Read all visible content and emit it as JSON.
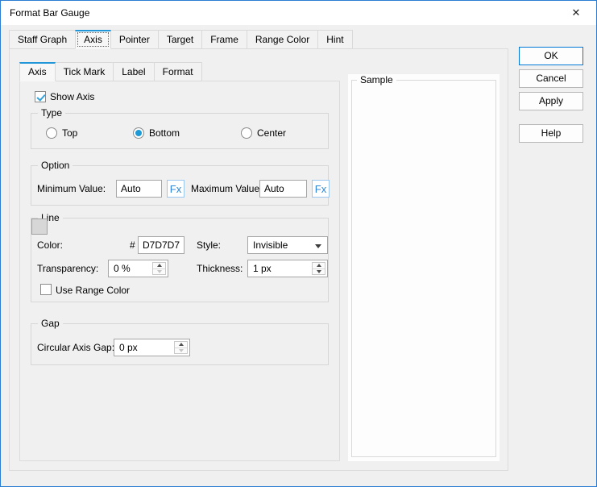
{
  "window": {
    "title": "Format Bar Gauge"
  },
  "icons": {
    "close": "✕"
  },
  "tabs": {
    "active": "Axis",
    "items": [
      {
        "label": "Staff Graph"
      },
      {
        "label": "Axis"
      },
      {
        "label": "Pointer"
      },
      {
        "label": "Target"
      },
      {
        "label": "Frame"
      },
      {
        "label": "Range Color"
      },
      {
        "label": "Hint"
      }
    ]
  },
  "subtabs": {
    "active": "Axis",
    "items": [
      {
        "label": "Axis"
      },
      {
        "label": "Tick Mark"
      },
      {
        "label": "Label"
      },
      {
        "label": "Format"
      }
    ]
  },
  "axis_page": {
    "show_axis": {
      "label": "Show Axis",
      "checked": true
    },
    "type_group": {
      "title": "Type",
      "options": [
        {
          "label": "Top",
          "selected": false
        },
        {
          "label": "Bottom",
          "selected": true
        },
        {
          "label": "Center",
          "selected": false
        }
      ]
    },
    "option_group": {
      "title": "Option",
      "minimum": {
        "label": "Minimum Value:",
        "value": "Auto",
        "fx_label": "Fx"
      },
      "maximum": {
        "label": "Maximum Value:",
        "value": "Auto",
        "fx_label": "Fx"
      }
    },
    "line_group": {
      "title": "Line",
      "color": {
        "label": "Color:",
        "hash": "#",
        "swatch_hex": "#D7D7D7",
        "swatch_style": "background:#D7D7D7",
        "value": "D7D7D7"
      },
      "style": {
        "label": "Style:",
        "value": "Invisible"
      },
      "transparency": {
        "label": "Transparency:",
        "value": "0 %"
      },
      "thickness": {
        "label": "Thickness:",
        "value": "1 px"
      },
      "use_range_color": {
        "label": "Use Range Color",
        "checked": false
      }
    },
    "gap_group": {
      "title": "Gap",
      "circular_axis_gap": {
        "label": "Circular Axis Gap:",
        "value": "0 px"
      }
    }
  },
  "sample_group": {
    "title": "Sample"
  },
  "buttons": {
    "ok": "OK",
    "cancel": "Cancel",
    "apply": "Apply",
    "help": "Help"
  },
  "colors": {
    "accent": "#0078d7",
    "tab_highlight": "#2196d9",
    "window_border": "#2b7cd3",
    "swatch": "#D7D7D7"
  }
}
